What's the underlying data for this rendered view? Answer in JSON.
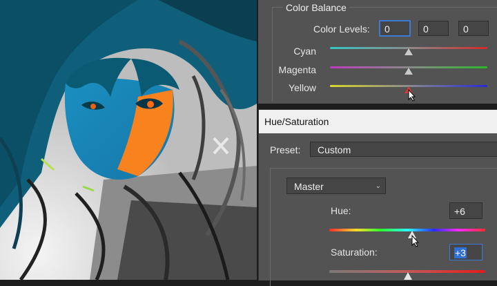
{
  "color_balance": {
    "title": "Color Balance",
    "levels_label": "Color Levels:",
    "levels": [
      "0",
      "0",
      "0"
    ],
    "sliders": [
      {
        "label": "Cyan",
        "value": 0
      },
      {
        "label": "Magenta",
        "value": 0
      },
      {
        "label": "Yellow",
        "value": 0
      }
    ]
  },
  "hue_saturation": {
    "title": "Hue/Saturation",
    "preset_label": "Preset:",
    "preset_value": "Custom",
    "channel": "Master",
    "hue_label": "Hue:",
    "hue_value": "+6",
    "saturation_label": "Saturation:",
    "saturation_value": "+3"
  },
  "colors": {
    "panel": "#535353",
    "accent": "#3d7ad8",
    "selected_thumb": "#d83b3b"
  }
}
